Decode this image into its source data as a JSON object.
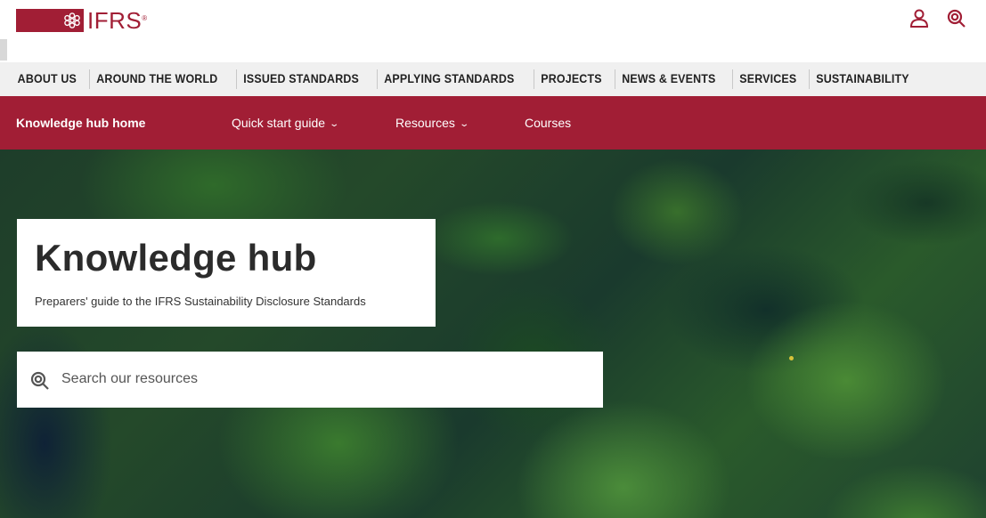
{
  "header": {
    "logo_text": "IFRS",
    "logo_mark": "®",
    "user_icon": "user-icon",
    "search_icon": "search-icon"
  },
  "primary_nav": {
    "items": [
      {
        "label": "ABOUT US"
      },
      {
        "label": "AROUND THE WORLD"
      },
      {
        "label": "ISSUED STANDARDS"
      },
      {
        "label": "APPLYING STANDARDS"
      },
      {
        "label": "PROJECTS"
      },
      {
        "label": "NEWS & EVENTS"
      },
      {
        "label": "SERVICES"
      },
      {
        "label": "SUSTAINABILITY"
      }
    ]
  },
  "secondary_nav": {
    "items": [
      {
        "label": "Knowledge hub home",
        "active": true
      },
      {
        "label": "Quick start guide",
        "has_dropdown": true
      },
      {
        "label": "Resources",
        "has_dropdown": true
      },
      {
        "label": "Courses"
      }
    ]
  },
  "hero": {
    "title": "Knowledge hub",
    "subtitle": "Preparers' guide to the IFRS Sustainability Disclosure Standards",
    "search_placeholder": "Search our resources"
  },
  "colors": {
    "brand": "#a11e35",
    "nav_bg": "#f0f0f0",
    "text_dark": "#222222"
  }
}
